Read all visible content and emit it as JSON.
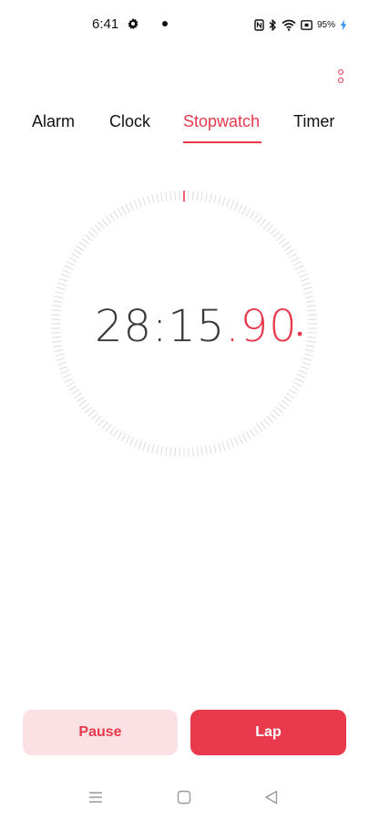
{
  "status_bar": {
    "time": "6:41",
    "battery": "95%",
    "icons": [
      "gear-icon",
      "notification-dot-icon",
      "nfc-icon",
      "bluetooth-icon",
      "wifi-icon",
      "battery-icon",
      "charging-icon"
    ]
  },
  "tabs": [
    {
      "label": "Alarm",
      "active": false
    },
    {
      "label": "Clock",
      "active": false
    },
    {
      "label": "Stopwatch",
      "active": true
    },
    {
      "label": "Timer",
      "active": false
    }
  ],
  "stopwatch": {
    "minutes_seconds": "28:15",
    "hundredths": ".90"
  },
  "buttons": {
    "pause": "Pause",
    "lap": "Lap"
  },
  "colors": {
    "accent": "#e8394d",
    "pause_bg": "#fbe1e4",
    "dial_ticks": "#dcdcdc"
  },
  "nav": {
    "icons": [
      "menu-icon",
      "home-icon",
      "back-icon"
    ]
  }
}
